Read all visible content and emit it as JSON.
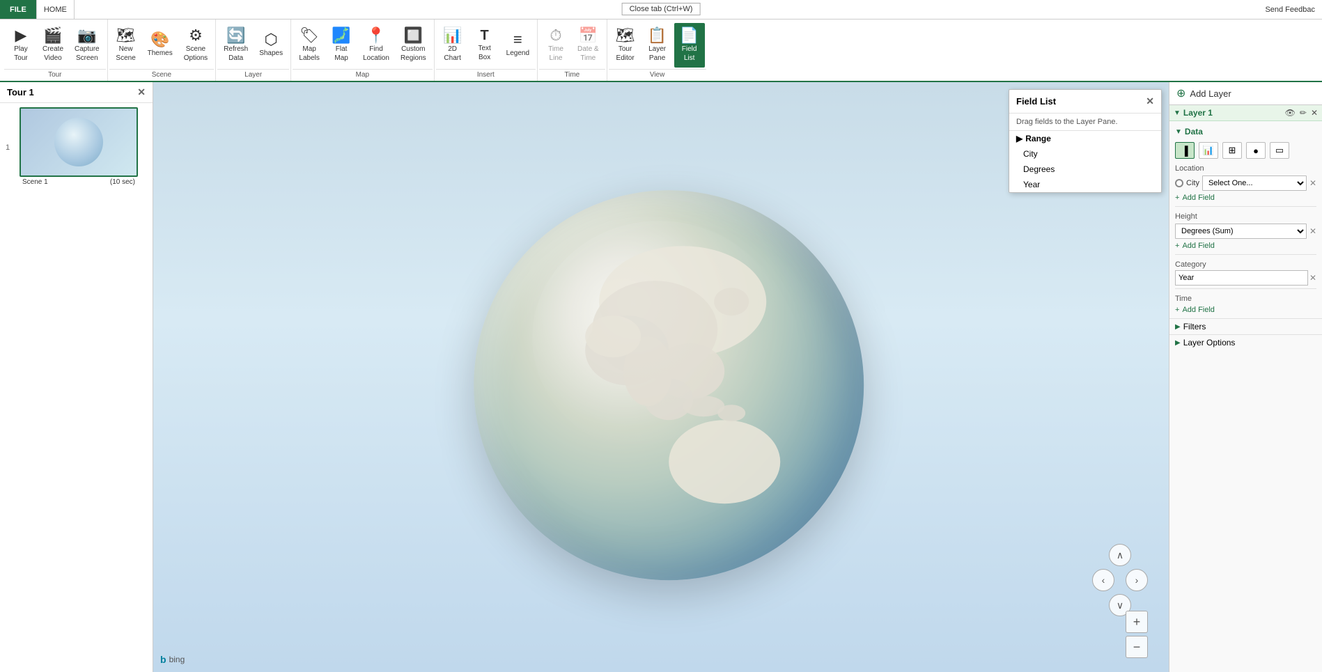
{
  "titlebar": {
    "file_label": "FILE",
    "home_label": "HOME",
    "close_tab_label": "Close tab (Ctrl+W)",
    "send_feedback_label": "Send Feedbac"
  },
  "ribbon": {
    "groups": [
      {
        "label": "Tour",
        "buttons": [
          {
            "id": "play-tour",
            "icon": "▶",
            "label": "Play\nTour"
          },
          {
            "id": "create-video",
            "icon": "🎬",
            "label": "Create\nVideo"
          },
          {
            "id": "capture-screen",
            "icon": "📷",
            "label": "Capture\nScreen"
          }
        ]
      },
      {
        "label": "Scene",
        "buttons": [
          {
            "id": "new-scene",
            "icon": "🗺",
            "label": "New\nScene"
          },
          {
            "id": "themes",
            "icon": "🎨",
            "label": "Themes"
          },
          {
            "id": "scene-options",
            "icon": "⚙",
            "label": "Scene\nOptions"
          }
        ]
      },
      {
        "label": "Layer",
        "buttons": [
          {
            "id": "refresh-data",
            "icon": "🔄",
            "label": "Refresh\nData"
          },
          {
            "id": "shapes",
            "icon": "⬡",
            "label": "Shapes"
          }
        ]
      },
      {
        "label": "Map",
        "buttons": [
          {
            "id": "map-labels",
            "icon": "🏷",
            "label": "Map\nLabels"
          },
          {
            "id": "flat-map",
            "icon": "🗾",
            "label": "Flat\nMap"
          },
          {
            "id": "find-location",
            "icon": "📍",
            "label": "Find\nLocation"
          },
          {
            "id": "custom-regions",
            "icon": "🔲",
            "label": "Custom\nRegions"
          }
        ]
      },
      {
        "label": "Insert",
        "buttons": [
          {
            "id": "2d-chart",
            "icon": "📊",
            "label": "2D\nChart"
          },
          {
            "id": "text-box",
            "icon": "T",
            "label": "Text\nBox"
          },
          {
            "id": "legend",
            "icon": "≡",
            "label": "Legend"
          }
        ]
      },
      {
        "label": "Time",
        "buttons": [
          {
            "id": "time-line",
            "icon": "⏱",
            "label": "Time\nLine",
            "disabled": true
          },
          {
            "id": "date-time",
            "icon": "📅",
            "label": "Date &\nTime",
            "disabled": true
          }
        ]
      },
      {
        "label": "View",
        "buttons": [
          {
            "id": "tour-editor",
            "icon": "🗺",
            "label": "Tour\nEditor"
          },
          {
            "id": "layer-pane",
            "icon": "📋",
            "label": "Layer\nPane"
          },
          {
            "id": "field-list",
            "icon": "📄",
            "label": "Field\nList"
          }
        ]
      }
    ]
  },
  "tour_panel": {
    "title": "Tour 1",
    "scenes": [
      {
        "number": "1",
        "name": "Scene 1",
        "duration": "(10 sec)"
      }
    ]
  },
  "field_list": {
    "title": "Field List",
    "description": "Drag fields to the Layer Pane.",
    "groups": [
      {
        "name": "Range",
        "fields": [
          "City",
          "Degrees",
          "Year"
        ]
      }
    ]
  },
  "right_panel": {
    "add_layer_label": "Add Layer",
    "layer": {
      "name": "Layer 1",
      "sections": {
        "data_label": "Data",
        "location_label": "Location",
        "location_field": "City",
        "location_placeholder": "Select One...",
        "height_label": "Height",
        "height_value": "Degrees (Sum)",
        "category_label": "Category",
        "category_value": "Year",
        "time_label": "Time",
        "add_field_label": "+ Add Field",
        "filters_label": "Filters",
        "layer_options_label": "Layer Options"
      }
    }
  },
  "globe": {
    "bing_label": "bing"
  },
  "nav": {
    "up": "∧",
    "left": "‹",
    "right": "›",
    "down": "∨",
    "zoom_in": "+",
    "zoom_out": "−"
  }
}
